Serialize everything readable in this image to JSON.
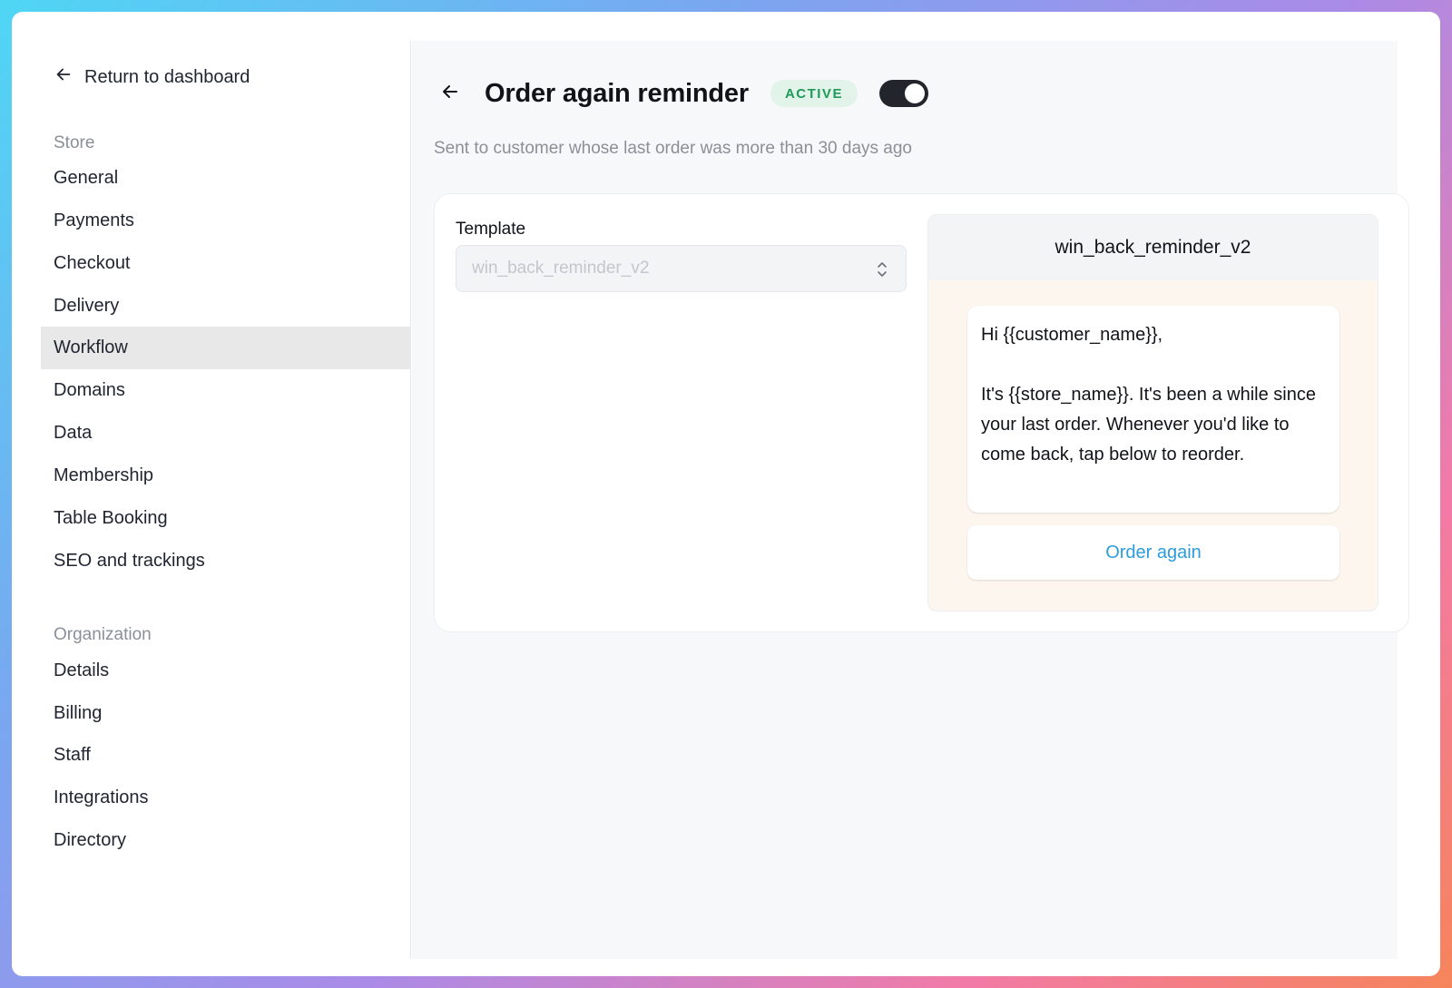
{
  "sidebar": {
    "return_label": "Return to dashboard",
    "store_section": "Store",
    "store_items": [
      {
        "label": "General"
      },
      {
        "label": "Payments"
      },
      {
        "label": "Checkout"
      },
      {
        "label": "Delivery"
      },
      {
        "label": "Workflow",
        "active": true
      },
      {
        "label": "Domains"
      },
      {
        "label": "Data"
      },
      {
        "label": "Membership"
      },
      {
        "label": "Table Booking"
      },
      {
        "label": "SEO and trackings"
      }
    ],
    "org_section": "Organization",
    "org_items": [
      {
        "label": "Details"
      },
      {
        "label": "Billing"
      },
      {
        "label": "Staff"
      },
      {
        "label": "Integrations"
      },
      {
        "label": "Directory"
      }
    ]
  },
  "header": {
    "title": "Order again reminder",
    "status": "ACTIVE",
    "enabled": true,
    "subtitle": "Sent to customer whose last order was more than 30 days ago"
  },
  "template": {
    "label": "Template",
    "value": "win_back_reminder_v2"
  },
  "preview": {
    "title": "win_back_reminder_v2",
    "greeting": "Hi {{customer_name}},",
    "body": "It's {{store_name}}. It's been a while since your last order. Whenever you'd like to come back, tap below to reorder.",
    "cta_label": "Order again"
  },
  "colors": {
    "accent_link": "#2d9cdb",
    "status_green": "#1e9a5a",
    "toggle_on": "#22252b"
  }
}
